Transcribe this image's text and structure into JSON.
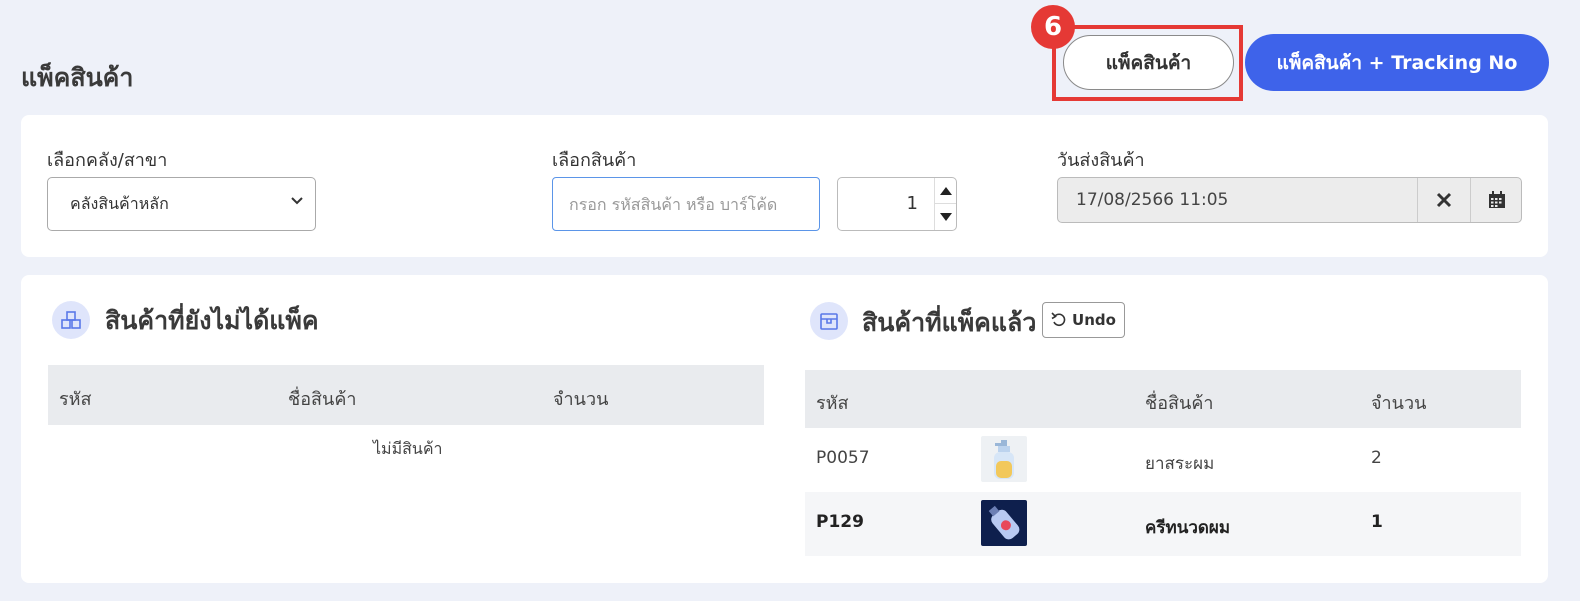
{
  "page": {
    "title": "แพ็คสินค้า"
  },
  "header": {
    "pack_button": "แพ็คสินค้า",
    "pack_tracking_button": "แพ็คสินค้า + Tracking No",
    "step_badge": "6"
  },
  "filters": {
    "warehouse": {
      "label": "เลือกคลัง/สาขา",
      "value": "คลังสินค้าหลัก"
    },
    "product": {
      "label": "เลือกสินค้า",
      "placeholder": "กรอก รหัสสินค้า หรือ บาร์โค้ด"
    },
    "quantity": {
      "value": "1"
    },
    "ship_date": {
      "label": "วันส่งสินค้า",
      "value": "17/08/2566 11:05"
    }
  },
  "unpacked": {
    "title": "สินค้าที่ยังไม่ได้แพ็ค",
    "columns": [
      "รหัส",
      "ชื่อสินค้า",
      "จำนวน"
    ],
    "empty_text": "ไม่มีสินค้า"
  },
  "packed": {
    "title": "สินค้าที่แพ็คแล้ว",
    "undo_label": "Undo",
    "columns": [
      "รหัส",
      "ชื่อสินค้า",
      "จำนวน"
    ],
    "rows": [
      {
        "code": "P0057",
        "name": "ยาสระผม",
        "qty": "2",
        "image": "shampoo-bottle"
      },
      {
        "code": "P129",
        "name": "ครีทนวดผม",
        "qty": "1",
        "image": "conditioner-tube"
      }
    ]
  },
  "colors": {
    "accent": "#3e63ea",
    "highlight": "#e53935",
    "background": "#eef1f9"
  }
}
